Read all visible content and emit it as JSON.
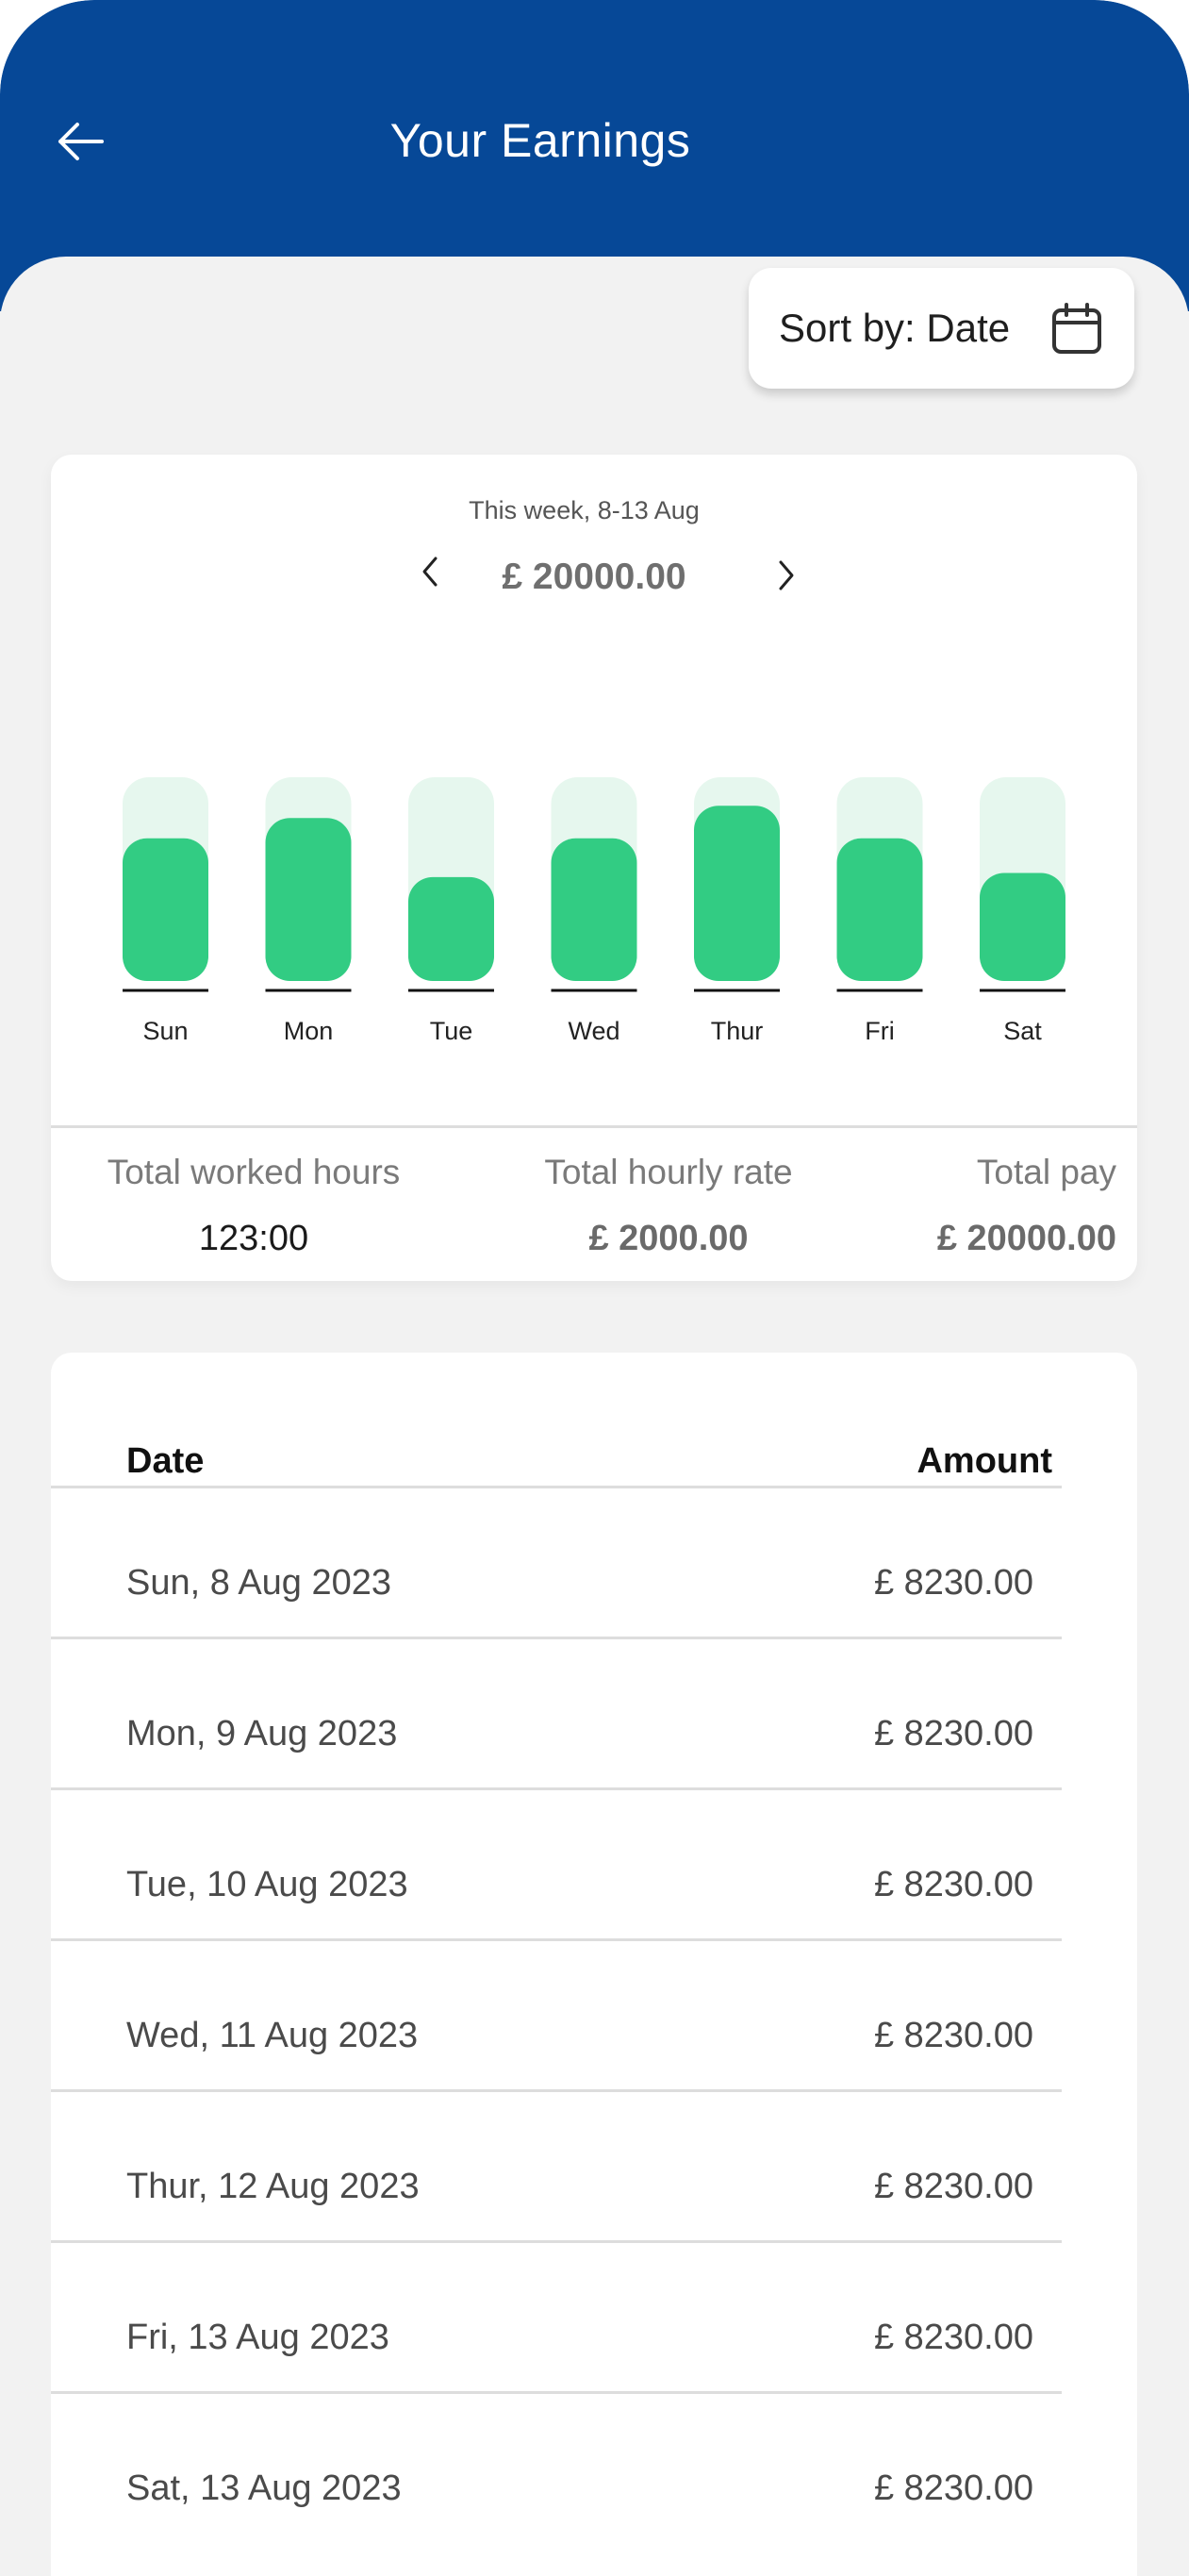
{
  "header": {
    "title": "Your Earnings",
    "back_icon": "arrow-left-icon"
  },
  "sort": {
    "label": "Sort by: Date",
    "icon": "calendar-icon"
  },
  "summary_chart": {
    "week_label": "This week, 8-13 Aug",
    "total": "£ 20000.00",
    "prev_icon": "chevron-left-icon",
    "next_icon": "chevron-right-icon"
  },
  "chart_data": {
    "type": "bar",
    "categories": [
      "Sun",
      "Mon",
      "Tue",
      "Wed",
      "Thur",
      "Fri",
      "Sat"
    ],
    "values": [
      0.7,
      0.8,
      0.51,
      0.7,
      0.86,
      0.7,
      0.53
    ],
    "ylim": [
      0,
      1
    ],
    "colors": {
      "bar": "#32cc83",
      "track": "#e6f7ee",
      "baseline": "#111111"
    }
  },
  "totals": {
    "hours_label": "Total worked hours",
    "hours_value": "123:00",
    "rate_label": "Total hourly rate",
    "rate_value": "£ 2000.00",
    "pay_label": "Total pay",
    "pay_value": "£ 20000.00"
  },
  "list": {
    "date_header": "Date",
    "amount_header": "Amount",
    "rows": [
      {
        "date": "Sun, 8 Aug 2023",
        "amount": "£ 8230.00"
      },
      {
        "date": "Mon, 9 Aug 2023",
        "amount": "£ 8230.00"
      },
      {
        "date": "Tue, 10 Aug 2023",
        "amount": "£ 8230.00"
      },
      {
        "date": "Wed, 11 Aug 2023",
        "amount": "£ 8230.00"
      },
      {
        "date": "Thur, 12  Aug 2023",
        "amount": "£ 8230.00"
      },
      {
        "date": "Fri, 13  Aug 2023",
        "amount": "£ 8230.00"
      },
      {
        "date": "Sat, 13  Aug 2023",
        "amount": "£ 8230.00"
      }
    ]
  },
  "colors": {
    "header_bg": "#064897",
    "page_bg": "#f2f2f2",
    "accent_green": "#32cc83"
  }
}
